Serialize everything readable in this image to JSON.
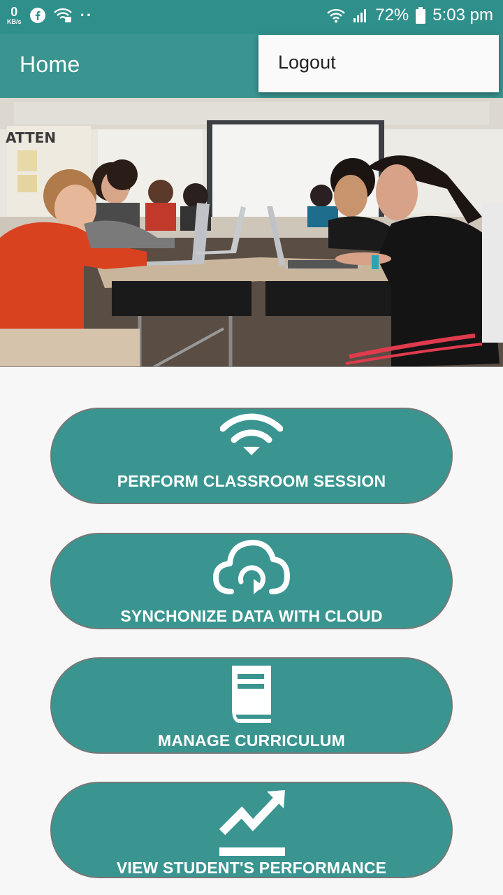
{
  "status_bar": {
    "net_speed_value": "0",
    "net_speed_unit": "KB/s",
    "battery": "72%",
    "time": "5:03 pm",
    "icons": [
      "facebook-icon",
      "wifi-vpn-icon",
      "more-dots-icon",
      "wifi-signal-icon",
      "cell-signal-icon",
      "battery-icon"
    ]
  },
  "app_bar": {
    "title": "Home"
  },
  "overflow_menu": {
    "items": [
      {
        "label": "Logout"
      }
    ]
  },
  "actions": [
    {
      "label": "PERFORM CLASSROOM SESSION",
      "icon": "wifi-icon"
    },
    {
      "label": "SYNCHONIZE DATA WITH CLOUD",
      "icon": "cloud-sync-icon"
    },
    {
      "label": "MANAGE CURRICULUM",
      "icon": "book-icon"
    },
    {
      "label": "VIEW STUDENT'S PERFORMANCE",
      "icon": "trend-chart-icon"
    }
  ],
  "colors": {
    "primary": "#3a9590",
    "status_bar": "#2f8f8b",
    "background": "#f7f7f7"
  }
}
